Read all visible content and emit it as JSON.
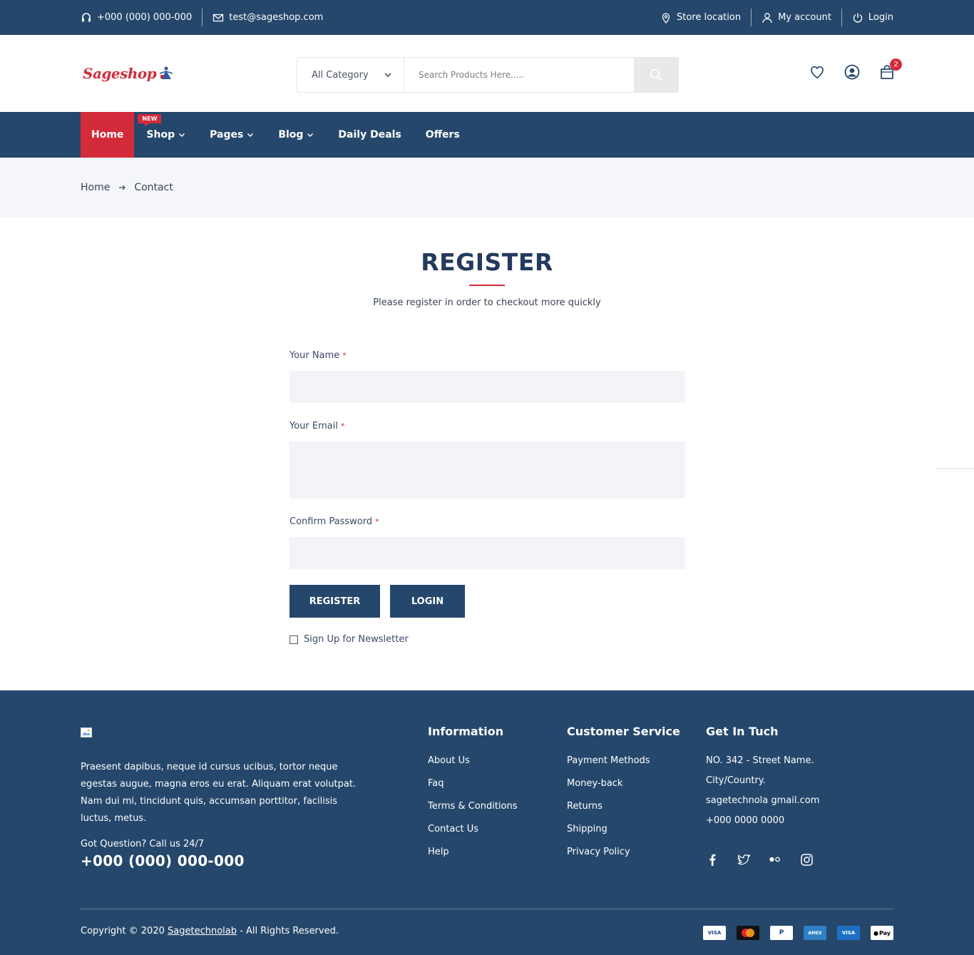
{
  "topbar": {
    "phone": "+000 (000) 000-000",
    "email": "test@sageshop.com",
    "store_location": "Store location",
    "my_account": "My account",
    "login": "Login"
  },
  "header": {
    "logo_text": "Sageshop",
    "category_label": "All Category",
    "search_placeholder": "Search Products Here.....",
    "cart_count": "2"
  },
  "nav": {
    "items": [
      {
        "label": "Home",
        "active": true
      },
      {
        "label": "Shop",
        "badge": "NEW"
      },
      {
        "label": "Pages"
      },
      {
        "label": "Blog"
      },
      {
        "label": "Daily Deals"
      },
      {
        "label": "Offers"
      }
    ]
  },
  "breadcrumb": {
    "items": [
      "Home",
      "Contact"
    ]
  },
  "register": {
    "title": "REGISTER",
    "subtitle": "Please register in order to checkout more quickly",
    "name_label": "Your Name",
    "email_label": "Your Email",
    "confirm_label": "Confirm Password",
    "required_mark": "*",
    "register_button": "REGISTER",
    "login_button": "LOGIN",
    "newsletter_label": "Sign Up for Newsletter"
  },
  "footer": {
    "about": "Praesent dapibus, neque id cursus ucibus, tortor neque egestas augue, magna eros eu erat. Aliquam erat volutpat. Nam dui mi, tincidunt quis, accumsan porttitor, facilisis luctus, metus.",
    "question": "Got Question? Call us 24/7",
    "phone": "+000 (000) 000-000",
    "information": {
      "title": "Information",
      "items": [
        "About Us",
        "Faq",
        "Terms & Conditions",
        "Contact Us",
        "Help"
      ]
    },
    "customer_service": {
      "title": "Customer Service",
      "items": [
        "Payment Methods",
        "Money-back",
        "Returns",
        "Shipping",
        "Privacy Policy"
      ]
    },
    "get_in_touch": {
      "title": "Get In Tuch",
      "items": [
        "NO. 342 - Street Name.",
        "City/Country.",
        "sagetechnola gmail.com",
        "+000 0000 0000"
      ]
    },
    "social": [
      "facebook-icon",
      "twitter-icon",
      "flickr-icon",
      "instagram-icon"
    ],
    "copyright_prefix": "Copyright © 2020 ",
    "copyright_link": "Sagetechnolab",
    "copyright_suffix": " - All Rights Reserved.",
    "payments": [
      "VISA",
      "mastercard",
      "PayPal",
      "AMEX",
      "VISA",
      "Pay"
    ]
  },
  "colors": {
    "primary": "#25476b",
    "accent": "#d42b3a",
    "input_bg": "#f3f4f8",
    "breadcrumb_bg": "#f4f6f9"
  }
}
